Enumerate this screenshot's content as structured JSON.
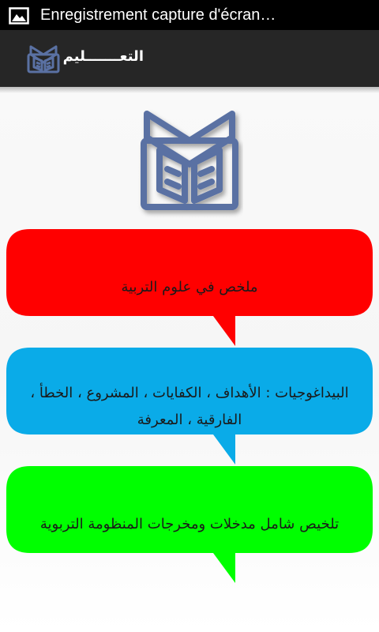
{
  "status_bar": {
    "notification_icon": "image-icon",
    "text": "Enregistrement capture d'écran…"
  },
  "action_bar": {
    "icon": "book-logo-icon",
    "title": "التعـــــــليم"
  },
  "colors": {
    "logo": "#5a71a3",
    "bubble_1": "#ff0000",
    "bubble_2": "#0aabe8",
    "bubble_3": "#00ff00"
  },
  "bubbles": [
    {
      "label": "ملخص في علوم التربية"
    },
    {
      "label": "البيداغوجيات : الأهداف ، الكفايات ، المشروع ، الخطأ ، الفارقية ، المعرفة"
    },
    {
      "label": "تلخيص   شامل  مدخلات ومخرجات المنظومة التربوية"
    }
  ]
}
